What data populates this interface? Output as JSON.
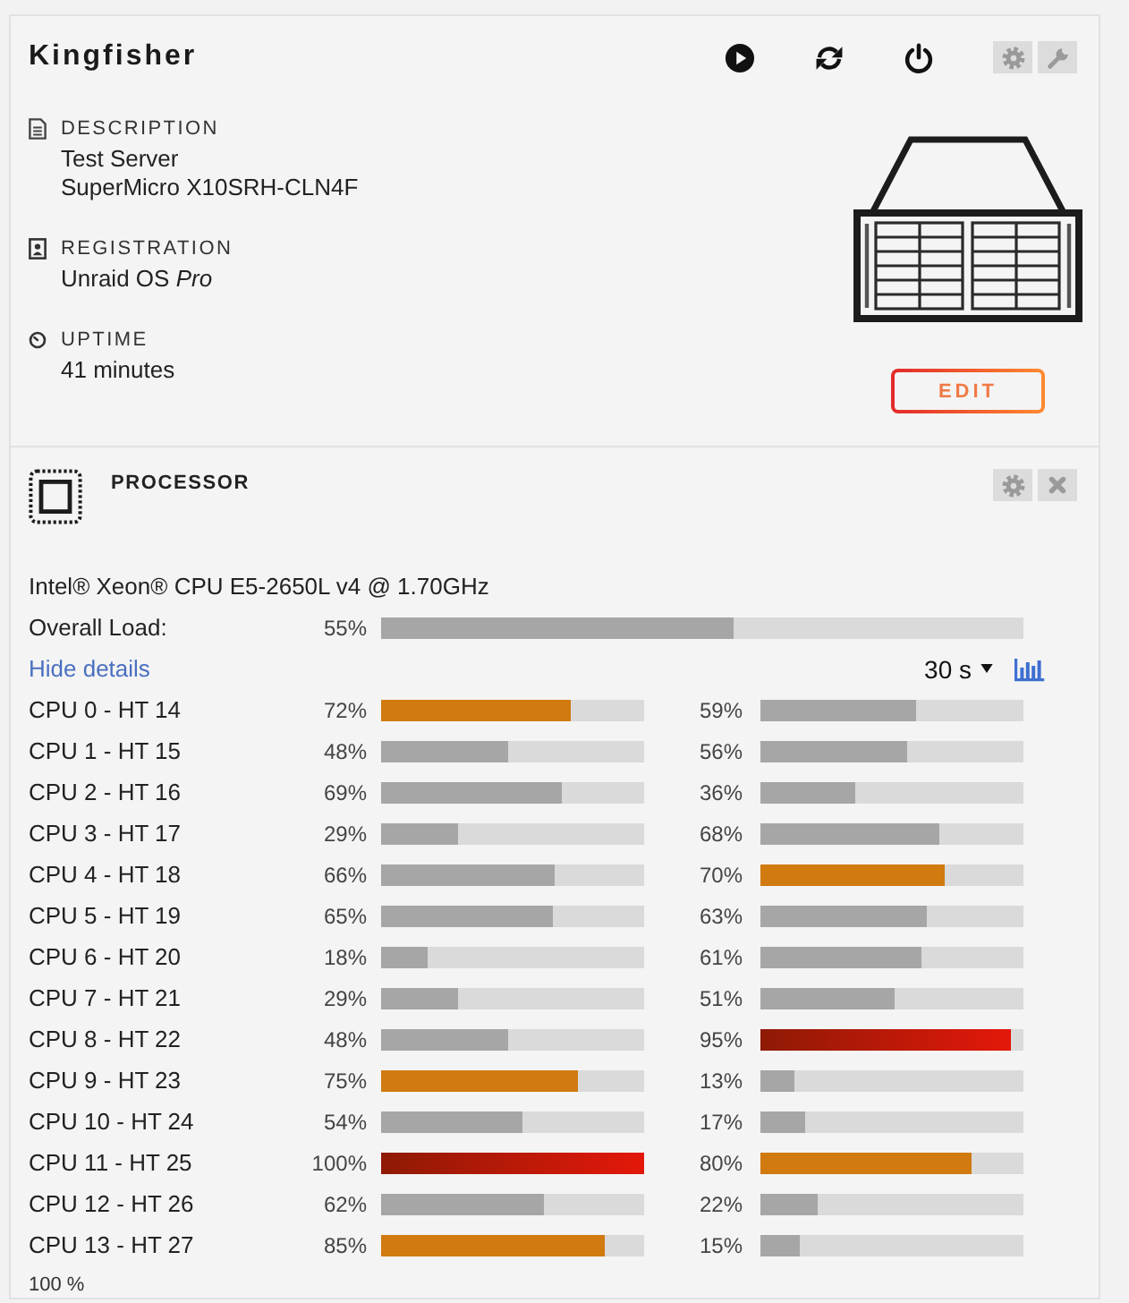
{
  "server": {
    "name": "Kingfisher",
    "sections": [
      {
        "kind": "description",
        "label": "DESCRIPTION",
        "lines": [
          "Test Server",
          "SuperMicro X10SRH-CLN4F"
        ]
      },
      {
        "kind": "registration",
        "label": "REGISTRATION",
        "lines": [
          "Unraid OS *Pro*"
        ]
      },
      {
        "kind": "uptime",
        "label": "UPTIME",
        "lines": [
          "41 minutes"
        ]
      }
    ],
    "edit_button": "EDIT"
  },
  "processor": {
    "title": "PROCESSOR",
    "model": "Intel® Xeon® CPU E5-2650L v4 @ 1.70GHz",
    "overall": {
      "label": "Overall Load:",
      "reading": "55%",
      "level": 0.55
    },
    "details_link": "Hide details",
    "interval": "30 s",
    "cores": [
      {
        "label": "CPU 0 - HT 14",
        "cpu": {
          "reading": "72%",
          "level": 0.72
        },
        "ht": {
          "reading": "59%",
          "level": 0.59
        }
      },
      {
        "label": "CPU 1 - HT 15",
        "cpu": {
          "reading": "48%",
          "level": 0.48
        },
        "ht": {
          "reading": "56%",
          "level": 0.56
        }
      },
      {
        "label": "CPU 2 - HT 16",
        "cpu": {
          "reading": "69%",
          "level": 0.69
        },
        "ht": {
          "reading": "36%",
          "level": 0.36
        }
      },
      {
        "label": "CPU 3 - HT 17",
        "cpu": {
          "reading": "29%",
          "level": 0.29
        },
        "ht": {
          "reading": "68%",
          "level": 0.68
        }
      },
      {
        "label": "CPU 4 - HT 18",
        "cpu": {
          "reading": "66%",
          "level": 0.66
        },
        "ht": {
          "reading": "70%",
          "level": 0.7
        }
      },
      {
        "label": "CPU 5 - HT 19",
        "cpu": {
          "reading": "65%",
          "level": 0.65
        },
        "ht": {
          "reading": "63%",
          "level": 0.63
        }
      },
      {
        "label": "CPU 6 - HT 20",
        "cpu": {
          "reading": "18%",
          "level": 0.18
        },
        "ht": {
          "reading": "61%",
          "level": 0.61
        }
      },
      {
        "label": "CPU 7 - HT 21",
        "cpu": {
          "reading": "29%",
          "level": 0.29
        },
        "ht": {
          "reading": "51%",
          "level": 0.51
        }
      },
      {
        "label": "CPU 8 - HT 22",
        "cpu": {
          "reading": "48%",
          "level": 0.48
        },
        "ht": {
          "reading": "95%",
          "level": 0.95
        }
      },
      {
        "label": "CPU 9 - HT 23",
        "cpu": {
          "reading": "75%",
          "level": 0.75
        },
        "ht": {
          "reading": "13%",
          "level": 0.13
        }
      },
      {
        "label": "CPU 10 - HT 24",
        "cpu": {
          "reading": "54%",
          "level": 0.54
        },
        "ht": {
          "reading": "17%",
          "level": 0.17
        }
      },
      {
        "label": "CPU 11 - HT 25",
        "cpu": {
          "reading": "100%",
          "level": 1.0
        },
        "ht": {
          "reading": "80%",
          "level": 0.8
        }
      },
      {
        "label": "CPU 12 - HT 26",
        "cpu": {
          "reading": "62%",
          "level": 0.62
        },
        "ht": {
          "reading": "22%",
          "level": 0.22
        }
      },
      {
        "label": "CPU 13 - HT 27",
        "cpu": {
          "reading": "85%",
          "level": 0.85
        },
        "ht": {
          "reading": "15%",
          "level": 0.15
        }
      }
    ]
  },
  "bottom_text": "100 %"
}
